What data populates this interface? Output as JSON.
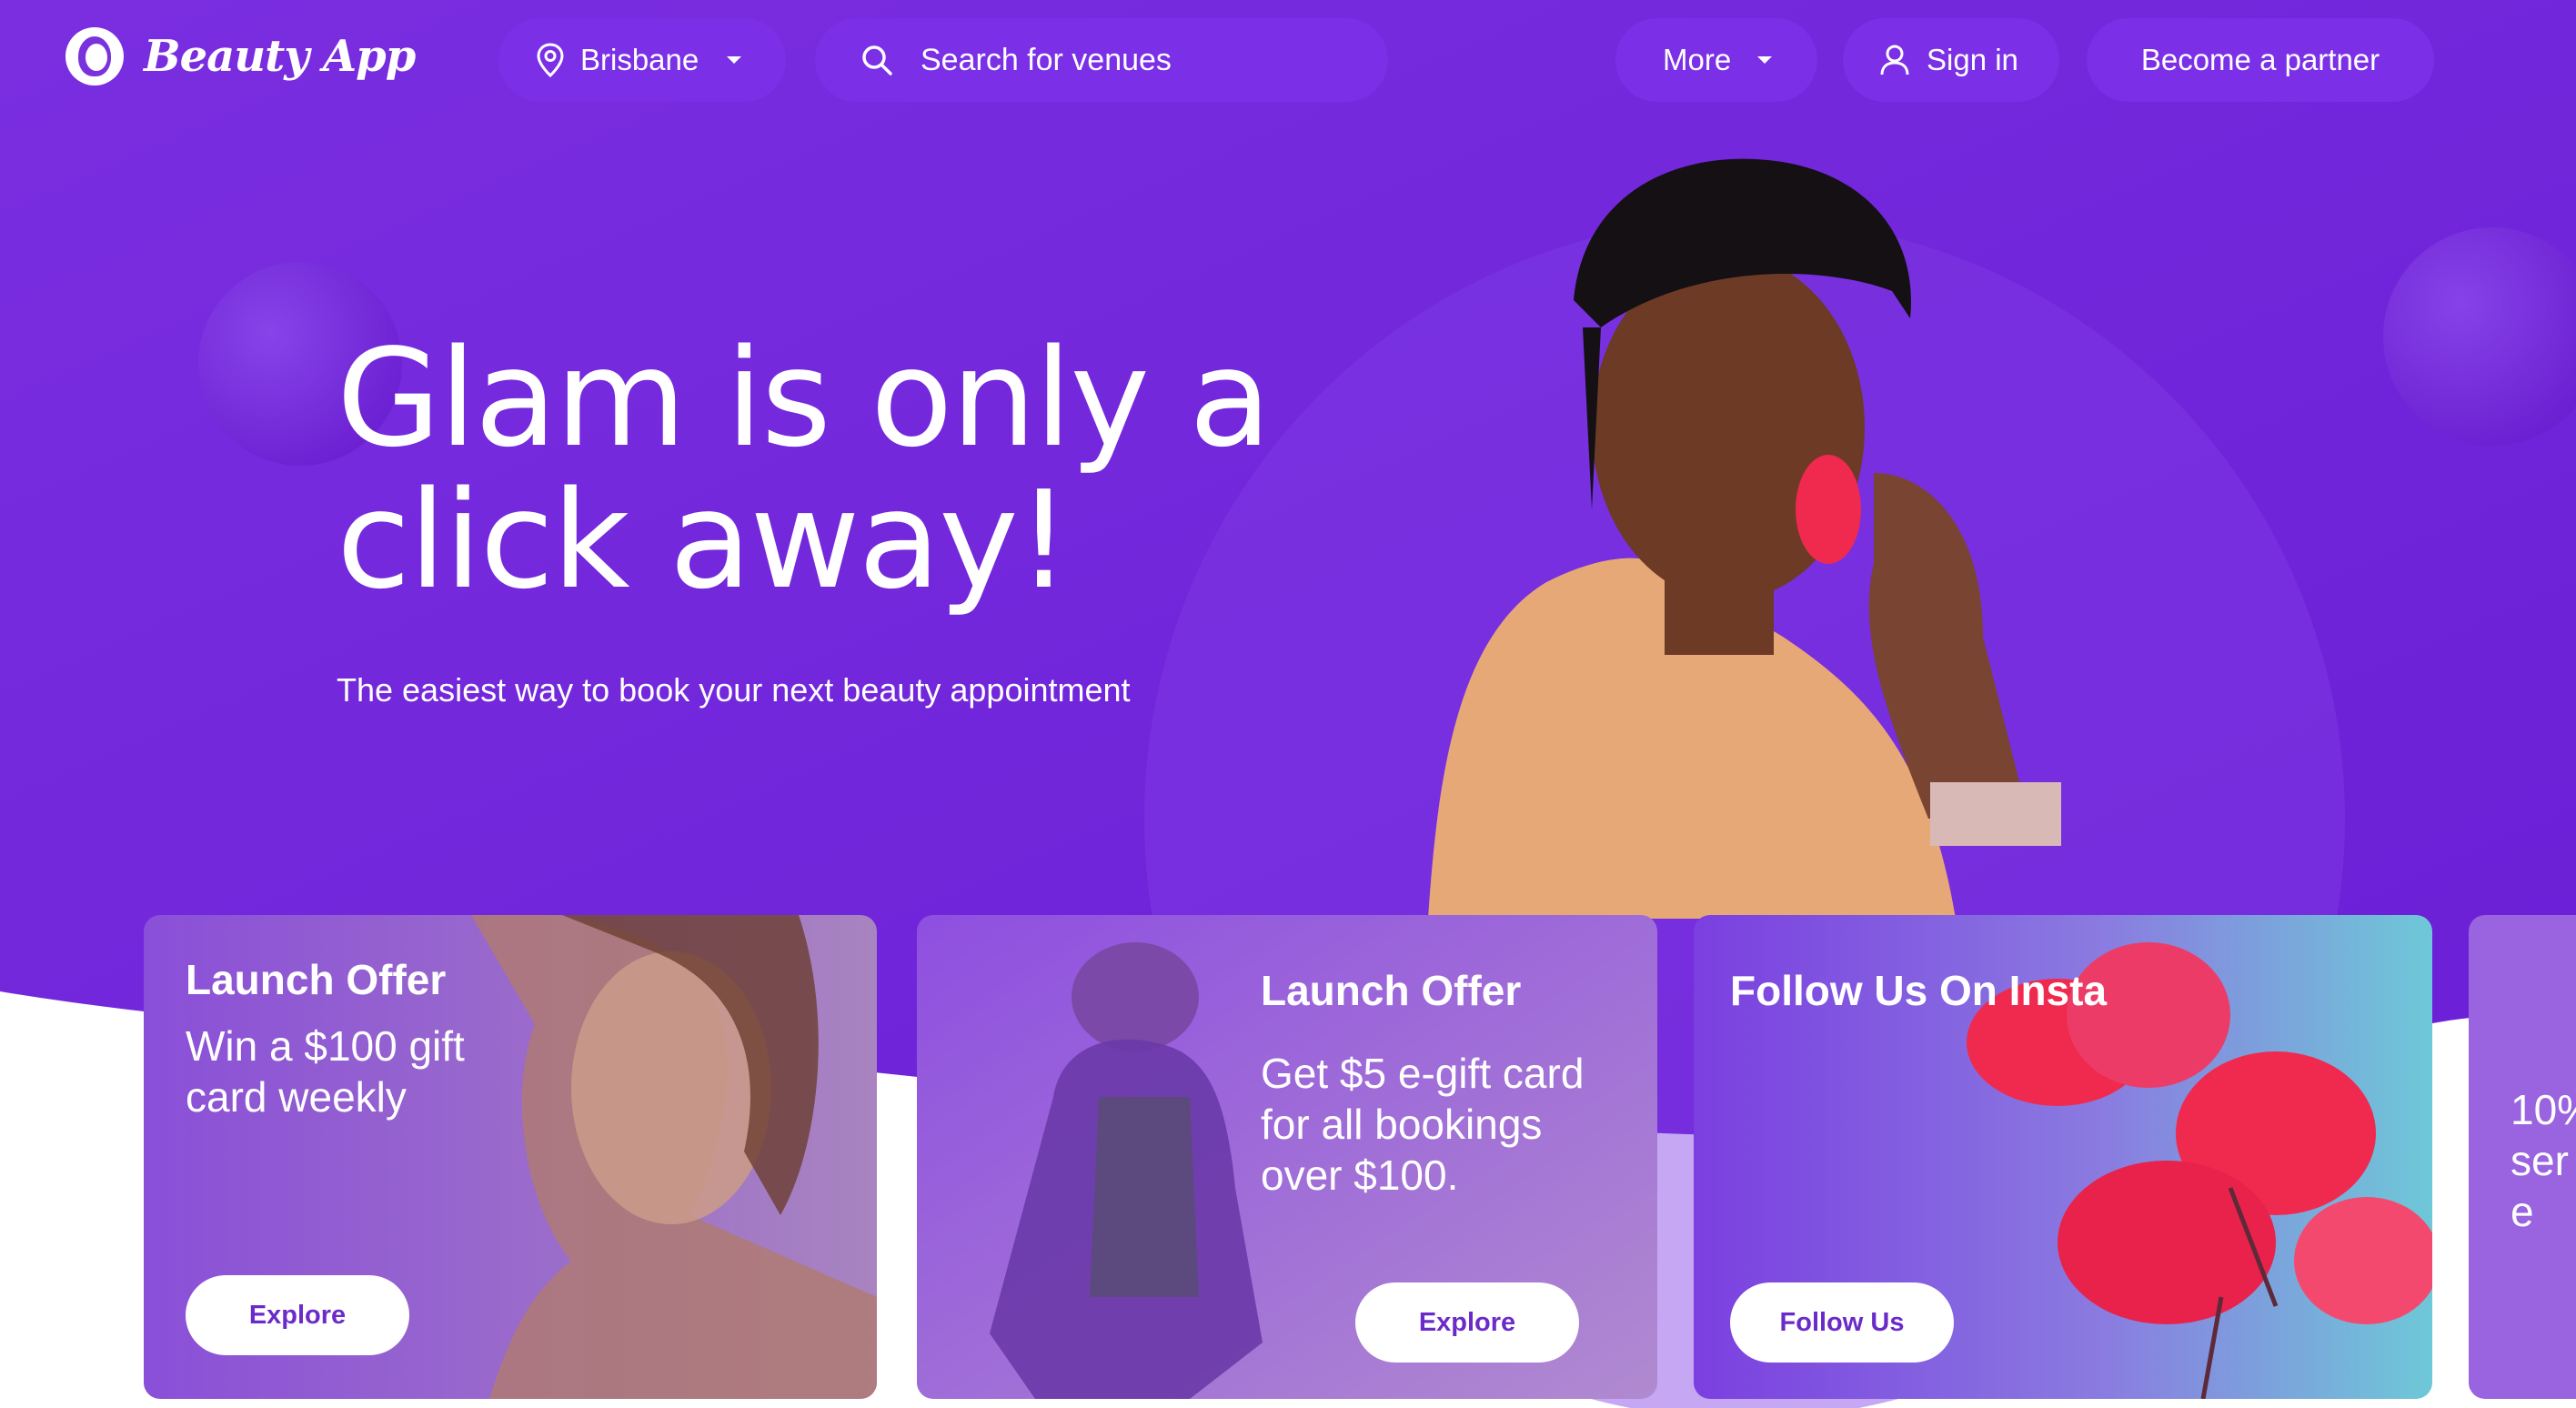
{
  "header": {
    "logo_text": "Beauty App",
    "location_label": "Brisbane",
    "search_placeholder": "Search for venues",
    "more_label": "More",
    "signin_label": "Sign in",
    "partner_label": "Become a partner"
  },
  "hero": {
    "title_line1": "Glam is only a",
    "title_line2": "click away!",
    "subtitle": "The easiest way to book your next beauty appointment"
  },
  "cards": [
    {
      "title": "Launch Offer",
      "line1": "Win a $100 gift",
      "line2": "card weekly",
      "button": "Explore"
    },
    {
      "title": "Launch Offer",
      "line1": "Get $5 e-gift card",
      "line2": "for all bookings",
      "line3": "over $100.",
      "button": "Explore"
    },
    {
      "title": "Follow Us On Insta",
      "button": "Follow Us"
    },
    {
      "line1": "10%",
      "line2": "ser",
      "line3": "e"
    }
  ],
  "colors": {
    "brand_purple": "#7a33dc",
    "pill_purple": "#7b2fe6",
    "button_text": "#6b2bc9",
    "accent_pink": "#f0294f"
  },
  "icons": [
    "location-pin-icon",
    "caret-down-icon",
    "search-icon",
    "user-icon"
  ]
}
